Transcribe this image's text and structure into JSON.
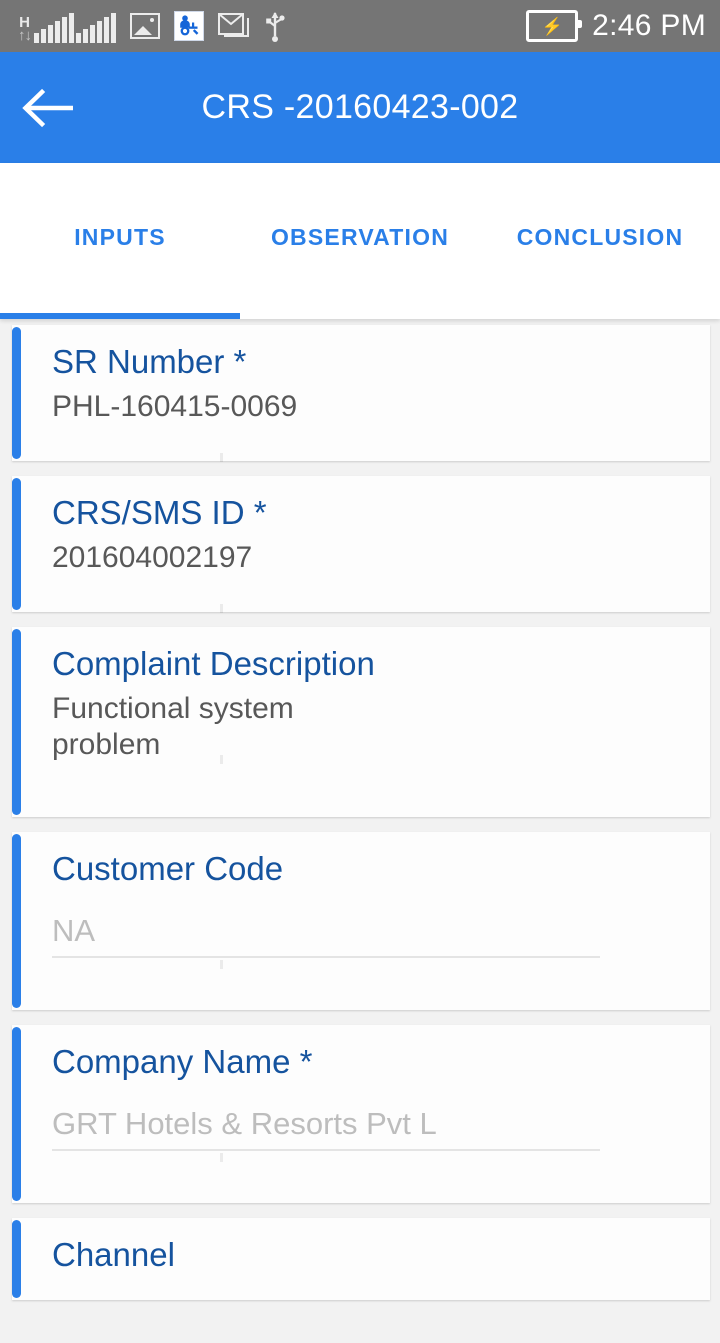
{
  "status_bar": {
    "network_type": "H",
    "data_arrows": "↑↓",
    "time": "2:46 PM",
    "icons": [
      {
        "name": "network-hspa-icon",
        "label": "H"
      },
      {
        "name": "signal-bars-icon-1",
        "label": "signal"
      },
      {
        "name": "signal-bars-icon-2",
        "label": "signal"
      },
      {
        "name": "screenshot-image-icon",
        "label": "image"
      },
      {
        "name": "service-app-icon",
        "label": "service"
      },
      {
        "name": "gmail-icon",
        "label": "gmail"
      },
      {
        "name": "usb-icon",
        "label": "usb"
      },
      {
        "name": "battery-charging-icon",
        "label": "battery"
      }
    ],
    "colors": {
      "background": "#757575",
      "foreground": "#ffffff"
    }
  },
  "app_bar": {
    "title": "CRS -20160423-002",
    "back_label": "←",
    "color": "#2a7fe8"
  },
  "tabs": {
    "active_index": 0,
    "items": [
      {
        "label": "INPUTS"
      },
      {
        "label": "OBSERVATION"
      },
      {
        "label": "CONCLUSION"
      }
    ],
    "accent_color": "#2a7fe8"
  },
  "form": {
    "fields": [
      {
        "label": "SR Number *",
        "value": "PHL-160415-0069",
        "type": "readonly"
      },
      {
        "label": "CRS/SMS ID *",
        "value": "201604002197",
        "type": "readonly"
      },
      {
        "label": "Complaint Description",
        "value": "Functional system\nproblem",
        "type": "readonly"
      },
      {
        "label": "Customer Code",
        "placeholder": "NA",
        "value": "",
        "type": "input"
      },
      {
        "label": "Company Name *",
        "placeholder": "GRT Hotels & Resorts Pvt L",
        "value": "",
        "type": "input"
      },
      {
        "label": "Channel",
        "value": "",
        "type": "input"
      }
    ]
  }
}
